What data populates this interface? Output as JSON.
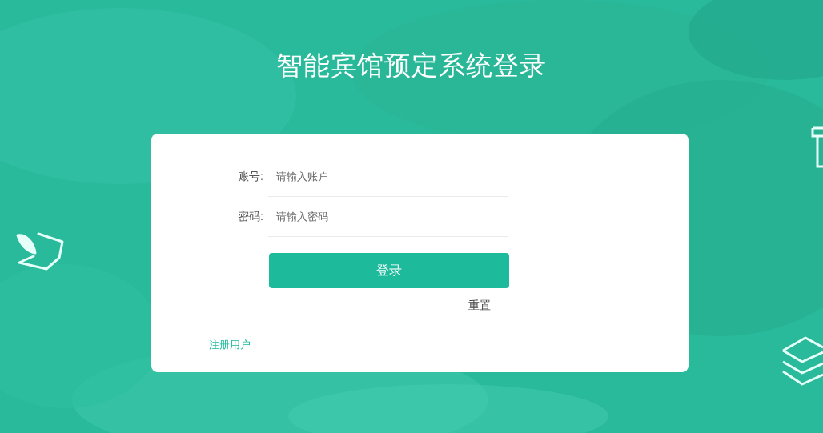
{
  "title": "智能宾馆预定系统登录",
  "fields": [
    {
      "label": "账号:",
      "placeholder": "请输入账户"
    },
    {
      "label": "密码:",
      "placeholder": "请输入密码"
    }
  ],
  "login_button": "登录",
  "reset_button": "重置",
  "register_link": "注册用户"
}
